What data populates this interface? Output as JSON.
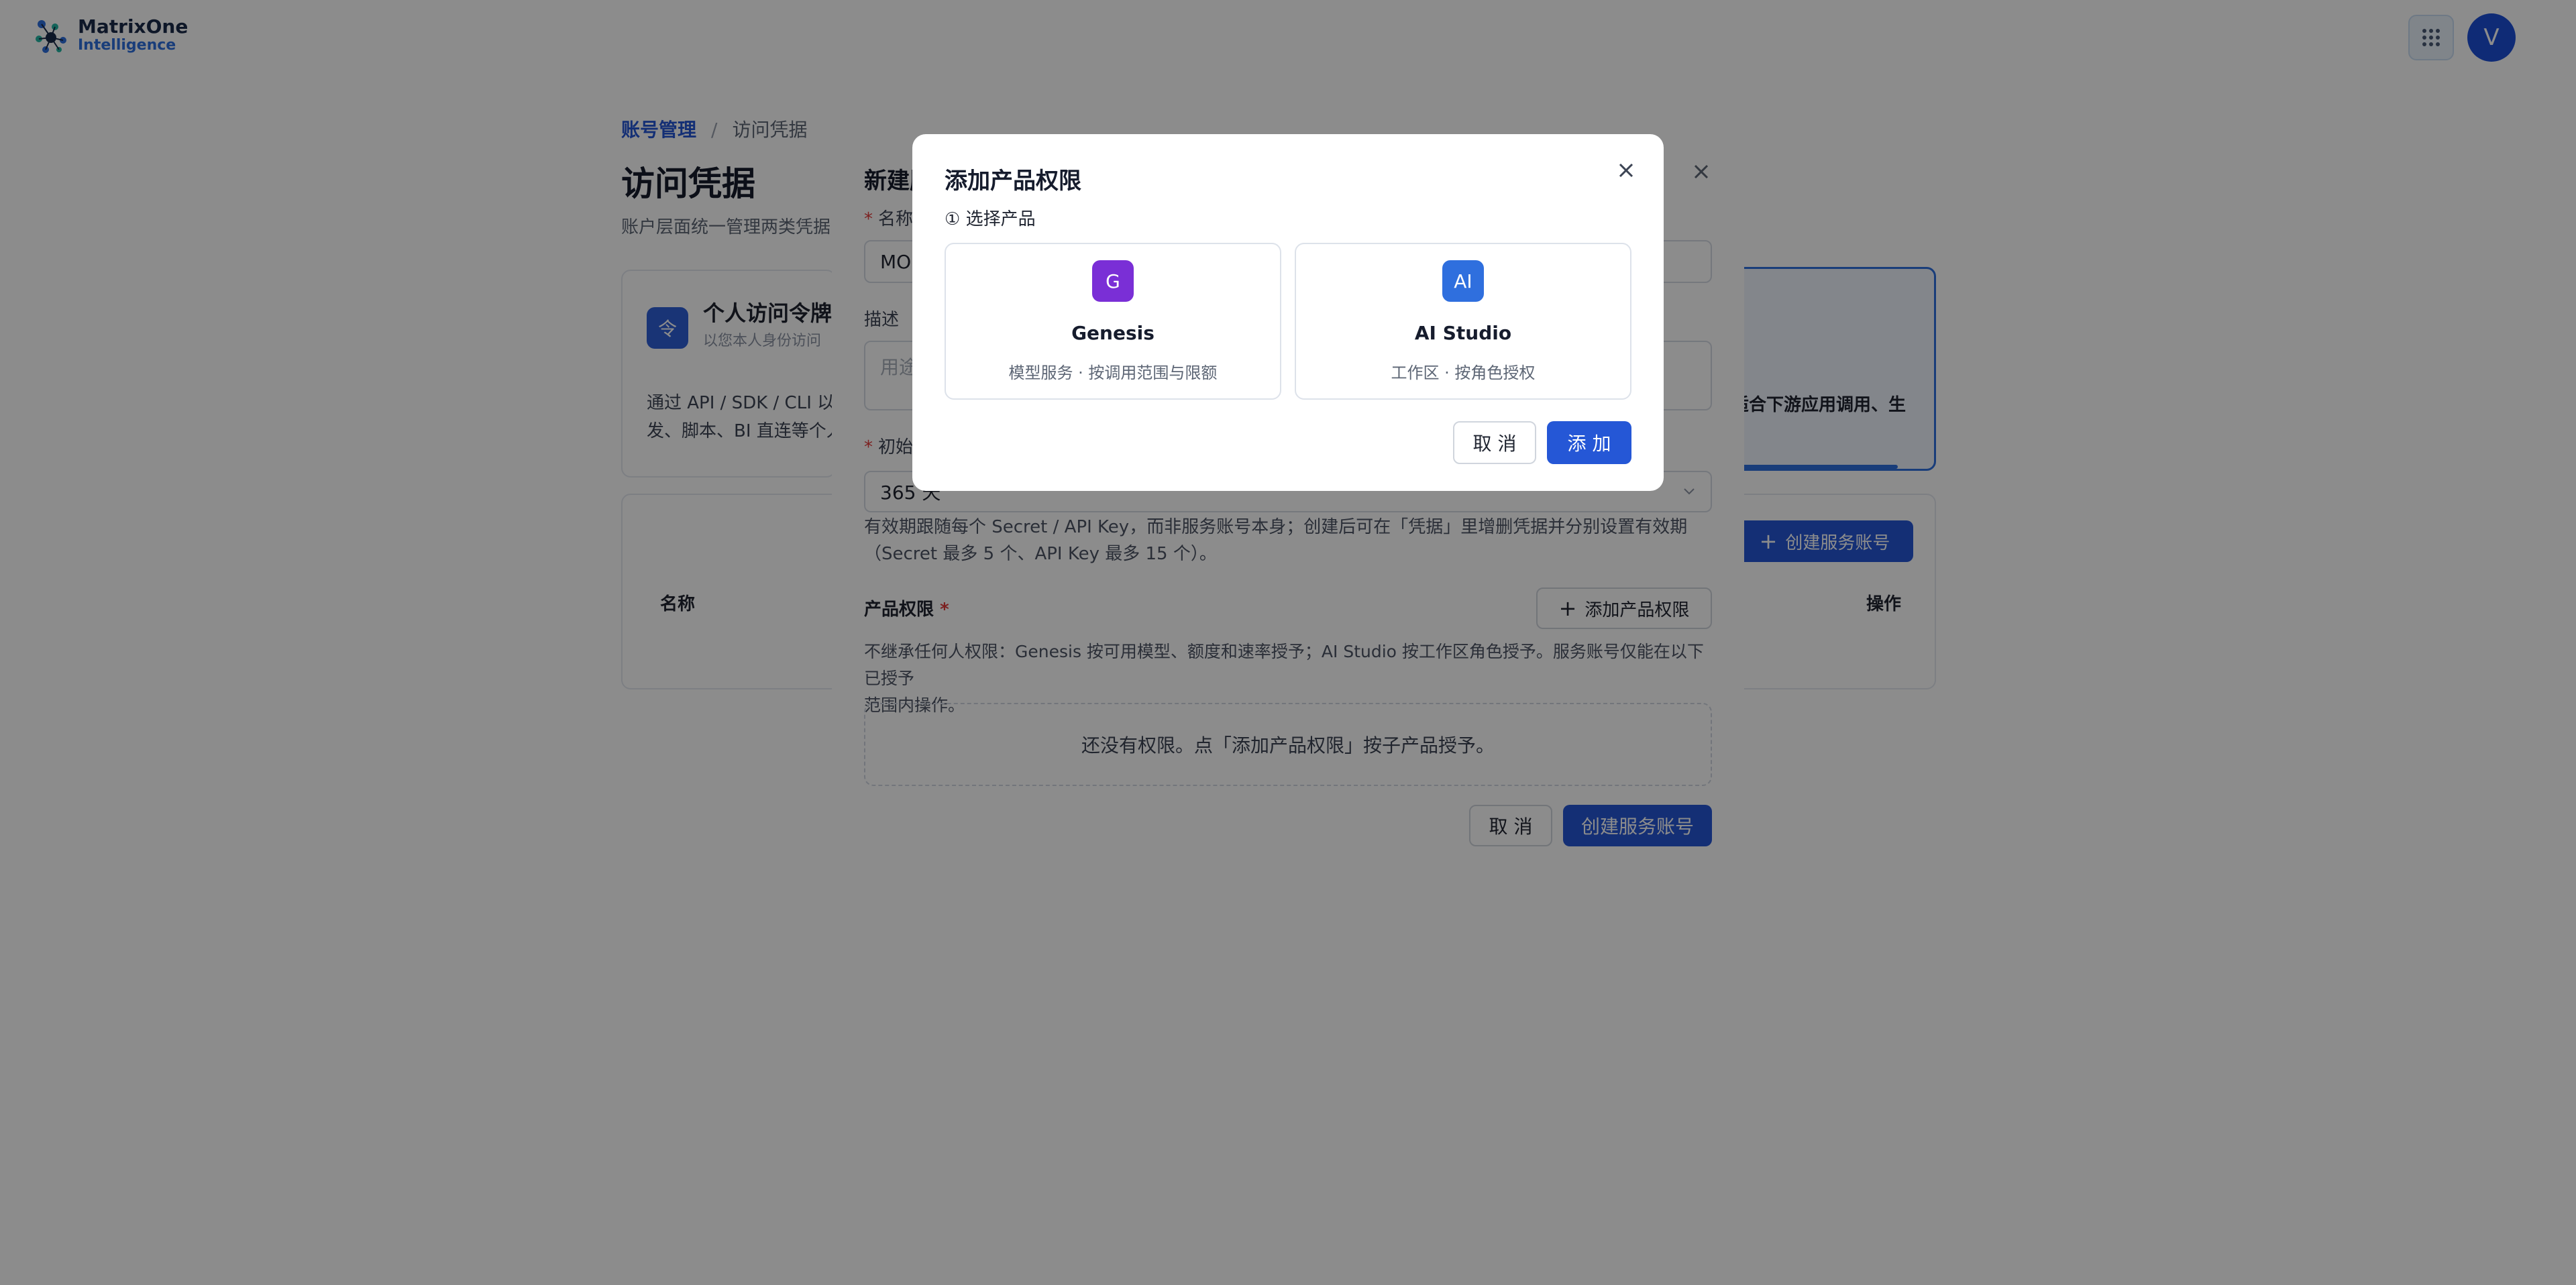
{
  "header": {
    "logo_line1": "MatrixOne",
    "logo_line2": "Intelligence",
    "avatar_initial": "V"
  },
  "page": {
    "breadcrumb": {
      "parent": "账号管理",
      "separator": "/",
      "current": "访问凭据"
    },
    "title": "访问凭据",
    "subtitle": "账户层面统一管理两类凭据",
    "pat_card": {
      "icon_text": "令",
      "title": "个人访问令牌",
      "subtitle": "以您本人身份访问",
      "desc_line1": "通过 API / SDK / CLI 以",
      "desc_line2": "发、脚本、BI 直连等个人"
    },
    "service_card": {
      "desc": "适合下游应用调用、生"
    },
    "list": {
      "create_button": "创建服务账号",
      "col_name": "名称",
      "col_actions": "操作"
    }
  },
  "dialog_create": {
    "title": "新建服",
    "name_label": "名称",
    "name_value": "MO",
    "desc_label": "描述",
    "desc_placeholder": "用途",
    "validity_label": "初始",
    "validity_value": "365 天",
    "validity_help_line1": "有效期跟随每个 Secret / API Key，而非服务账号本身；创建后可在「凭据」里增删凭据并分别设置有效期",
    "validity_help_line2": "（Secret 最多 5 个、API Key 最多 15 个）。",
    "perm_label": "产品权限",
    "add_perm_button": "添加产品权限",
    "perm_help_line1": "不继承任何人权限：Genesis 按可用模型、额度和速率授予；AI Studio 按工作区角色授予。服务账号仅能在以下已授予",
    "perm_help_line2": "范围内操作。",
    "perm_empty": "还没有权限。点「添加产品权限」按子产品授予。",
    "cancel_button": "取 消",
    "submit_button": "创建服务账号"
  },
  "dialog_add_permission": {
    "title": "添加产品权限",
    "step_label": "① 选择产品",
    "products": [
      {
        "badge": "G",
        "name": "Genesis",
        "desc": "模型服务 · 按调用范围与限额",
        "color": "#7a2fd6"
      },
      {
        "badge": "AI",
        "name": "AI Studio",
        "desc": "工作区 · 按角色授权",
        "color": "#2f6fde"
      }
    ],
    "cancel_button": "取 消",
    "confirm_button": "添 加"
  },
  "colors": {
    "primary": "#2557d6",
    "overlay": "rgba(0,0,0,0.45)",
    "required": "#e23b3b"
  }
}
